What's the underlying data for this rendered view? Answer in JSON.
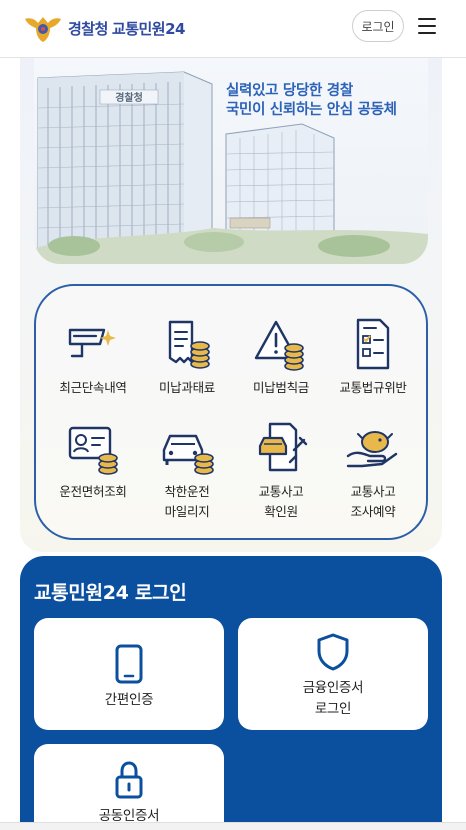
{
  "header": {
    "org_name": "경찰청",
    "service_name": "교통민원24",
    "login_label": "로그인",
    "logo_icon": "police-emblem-icon",
    "menu_icon": "hamburger-menu-icon"
  },
  "hero": {
    "tagline_line1": "실력있고 당당한 경찰",
    "tagline_line2": "국민이 신뢰하는 안심 공동체",
    "building_sign": "경찰청"
  },
  "services": [
    {
      "icon": "speed-camera-icon",
      "label": "최근단속내역"
    },
    {
      "icon": "unpaid-fee-receipt-icon",
      "label": "미납과태료"
    },
    {
      "icon": "unpaid-fine-warning-icon",
      "label": "미납범칙금"
    },
    {
      "icon": "traffic-violation-document-icon",
      "label": "교통법규위반"
    },
    {
      "icon": "license-card-icon",
      "label": "운전면허조회"
    },
    {
      "icon": "safe-driving-car-icon",
      "label": "착한운전",
      "label2": "마일리지"
    },
    {
      "icon": "accident-certificate-icon",
      "label": "교통사고",
      "label2": "확인원"
    },
    {
      "icon": "accident-appointment-icon",
      "label": "교통사고",
      "label2": "조사예약"
    }
  ],
  "login": {
    "title": "교통민원24 로그인",
    "options": [
      {
        "icon": "mobile-phone-icon",
        "label": "간편인증"
      },
      {
        "icon": "shield-icon",
        "label": "금융인증서",
        "label2": "로그인"
      },
      {
        "icon": "lock-icon",
        "label": "공동인증서"
      }
    ]
  },
  "colors": {
    "brand_blue": "#0b4f9f",
    "panel_border": "#2c5fa8",
    "accent_gold": "#e8b84a"
  }
}
